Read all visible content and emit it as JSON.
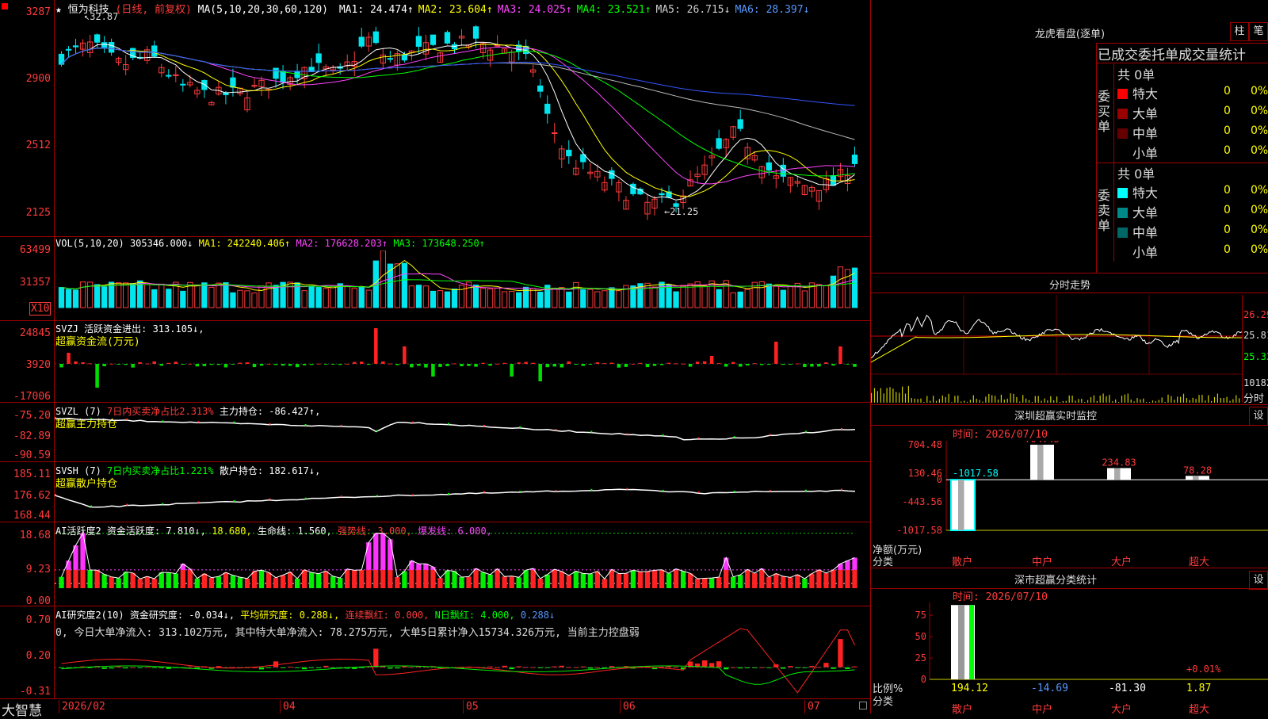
{
  "header": {
    "star": "★",
    "stock_name": "恒为科技",
    "mode": "(日线, 前复权)",
    "ma_params": "MA(5,10,20,30,60,120)",
    "ma": [
      {
        "label": "MA1:",
        "value": "24.474",
        "arrow": "↑",
        "color": "#ffffff"
      },
      {
        "label": "MA2:",
        "value": "23.604",
        "arrow": "↑",
        "color": "#ffff00"
      },
      {
        "label": "MA3:",
        "value": "24.025",
        "arrow": "↑",
        "color": "#ff44ff"
      },
      {
        "label": "MA4:",
        "value": "23.521",
        "arrow": "↑",
        "color": "#00ff00"
      },
      {
        "label": "MA5:",
        "value": "26.715",
        "arrow": "↓",
        "color": "#cccccc"
      },
      {
        "label": "MA6:",
        "value": "28.397",
        "arrow": "↓",
        "color": "#5599ff"
      }
    ]
  },
  "price_panel": {
    "y_labels": [
      "3287",
      "2900",
      "2512",
      "2125"
    ],
    "high_note": "32.87",
    "low_note": "21.25"
  },
  "vol_panel": {
    "head": "VOL(5,10,20)",
    "value": "305346.000↓",
    "ma1": "MA1: 242240.406↑",
    "ma2": "MA2: 176628.203↑",
    "ma3": "MA3: 173648.250↑",
    "y_labels": [
      "63499",
      "31357"
    ],
    "unit": "X10"
  },
  "svzj_panel": {
    "head": "SVZJ  活跃资金进出: 313.105↓,",
    "sub": "超赢资金流(万元)",
    "y_labels": [
      "24845",
      "3920",
      "-17006"
    ]
  },
  "svzl_panel": {
    "head1": "SVZL (7)",
    "head2": "7日内买卖净占比2.313%",
    "head3": "主力持仓: -86.427↑,",
    "sub": "超赢主力持仓",
    "y_labels": [
      "-75.20",
      "-82.89",
      "-90.59"
    ]
  },
  "svsh_panel": {
    "head1": "SVSH (7)",
    "head2": "7日内买卖净占比1.221%",
    "head3": "散户持仓: 182.617↓,",
    "sub": "超赢散户持仓",
    "y_labels": [
      "185.11",
      "176.62",
      "168.44"
    ]
  },
  "ai1_panel": {
    "head1": "AI活跃度2",
    "head2": "资金活跃度: 7.810↓,",
    "head3": "18.680,",
    "head4": "生命线: 1.560,",
    "head5": "强势线: 3.000,",
    "head6": "爆发线: 6.000,",
    "y_labels": [
      "18.68",
      "9.23",
      "0.00"
    ]
  },
  "ai2_panel": {
    "head1": "AI研究度2(10)",
    "head2": "资金研究度: -0.034↓,",
    "head3": "平均研究度: 0.288↓,",
    "head4": "连续飘红: 0.000,",
    "head5": "N日飘红: 4.000,",
    "head6": "0.288↓",
    "line2": "0, 今日大单净流入: 313.102万元, 其中特大单净流入: 78.275万元, 大单5日累计净入15734.326万元, 当前主力控盘弱",
    "y_labels": [
      "0.70",
      "0.20",
      "-0.31"
    ]
  },
  "xaxis": {
    "brand": "大智慧",
    "labels": [
      "2026/02",
      "04",
      "05",
      "06",
      "07"
    ]
  },
  "right": {
    "longhu_title": "龙虎看盘(逐单)",
    "btn_zhu": "柱",
    "btn_bi": "笔",
    "table_title": "已成交委托单成交量统计",
    "buy_side": "委买单",
    "sell_side": "委卖单",
    "buy_total": "共 0单",
    "sell_total": "共 0单",
    "buy_rows": [
      {
        "name": "特大",
        "value": "0",
        "pct": "0%",
        "color": "#ff0000"
      },
      {
        "name": "大单",
        "value": "0",
        "pct": "0%",
        "color": "#990000"
      },
      {
        "name": "中单",
        "value": "0",
        "pct": "0%",
        "color": "#660000"
      },
      {
        "name": "小单",
        "value": "0",
        "pct": "0%",
        "color": ""
      }
    ],
    "sell_rows": [
      {
        "name": "特大",
        "value": "0",
        "pct": "0%",
        "color": "#00ffff"
      },
      {
        "name": "大单",
        "value": "0",
        "pct": "0%",
        "color": "#008888"
      },
      {
        "name": "中单",
        "value": "0",
        "pct": "0%",
        "color": "#006666"
      },
      {
        "name": "小单",
        "value": "0",
        "pct": "0%",
        "color": ""
      }
    ],
    "fenshi_title": "分时走势",
    "fenshi_labels": [
      "26.29",
      "25.81",
      "25.33",
      "10182"
    ],
    "fenshi_unit": "分时",
    "sz_title": "深圳超赢实时监控",
    "sz_btn": "设",
    "sz_time": "时间: 2026/07/10",
    "sz_y": [
      "704.48",
      "130.46",
      "0",
      "-443.56",
      "-1017.58"
    ],
    "sz_bar_vals": [
      "-1017.58",
      "704.48",
      "234.83",
      "78.28"
    ],
    "sz_foot1": "净额(万元)",
    "sz_foot2": "分类",
    "categories": [
      "散户",
      "中户",
      "大户",
      "超大"
    ],
    "fl_title": "深市超赢分类统计",
    "fl_btn": "设",
    "fl_time": "时间: 2026/07/10",
    "fl_y": [
      "75",
      "50",
      "25",
      "0"
    ],
    "fl_vals": [
      "194.12",
      "-14.69",
      "-81.30",
      "1.87"
    ],
    "fl_note": "+0.01%",
    "fl_foot1": "比例%",
    "fl_foot2": "分类"
  }
}
